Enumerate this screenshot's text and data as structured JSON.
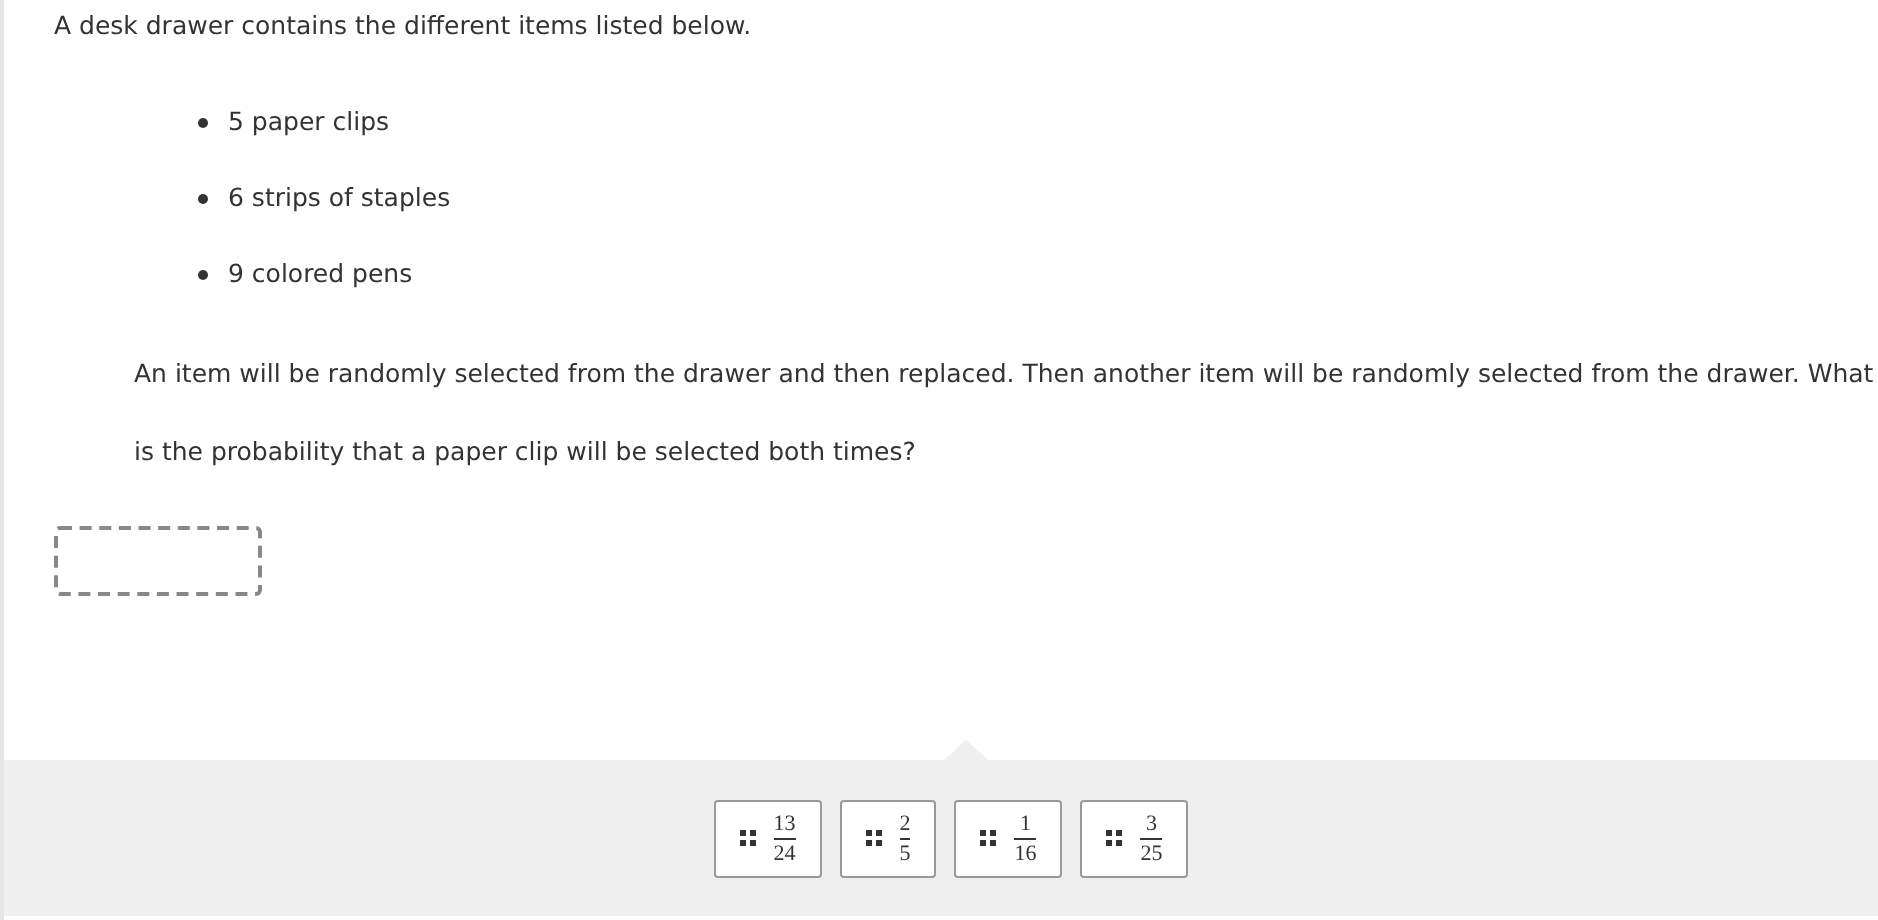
{
  "intro": "A desk drawer contains the different items listed below.",
  "items": [
    "5 paper clips",
    "6 strips of staples",
    "9 colored pens"
  ],
  "question": "An item will be randomly selected from the drawer and then replaced. Then another item will be randomly selected from the drawer. What is the probability that a paper clip will be selected both times?",
  "drop_box": {
    "filled": false
  },
  "choices": [
    {
      "numerator": "13",
      "denominator": "24"
    },
    {
      "numerator": "2",
      "denominator": "5"
    },
    {
      "numerator": "1",
      "denominator": "16"
    },
    {
      "numerator": "3",
      "denominator": "25"
    }
  ]
}
